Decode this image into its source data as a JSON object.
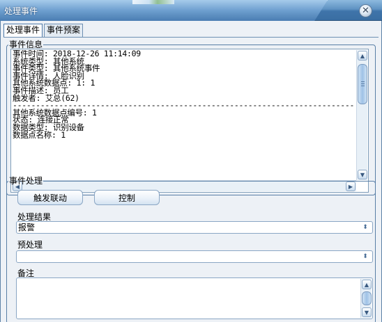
{
  "window": {
    "title": "处理事件"
  },
  "tabs": [
    {
      "label": "处理事件",
      "active": true
    },
    {
      "label": "事件预案",
      "active": false
    }
  ],
  "event_info": {
    "group_title": "事件信息",
    "lines": [
      "事件时间: 2018-12-26 11:14:09",
      "系统类型: 其他系统",
      "事件类型: 其他系统事件",
      "事件详情: 人脸识别",
      "其他系统数据点: 1: 1",
      "事件描述: 员工",
      "触发者: 艾总(62)",
      "------------------------------------------------------------------------------",
      "其他系统数据点编号: 1",
      "状态: 连接正常",
      "数据类型: 识别设备",
      "数据点名称: 1"
    ]
  },
  "event_handling": {
    "group_title": "事件处理",
    "trigger_button": "触发联动",
    "control_button": "控制",
    "result_label": "处理结果",
    "result_value": "报警",
    "preprocess_label": "预处理",
    "preprocess_value": "",
    "remark_label": "备注",
    "remark_value": ""
  },
  "colors": {
    "title_bar": "#5f92c3",
    "panel_bg": "#edf1f6",
    "border": "#587ea6"
  }
}
